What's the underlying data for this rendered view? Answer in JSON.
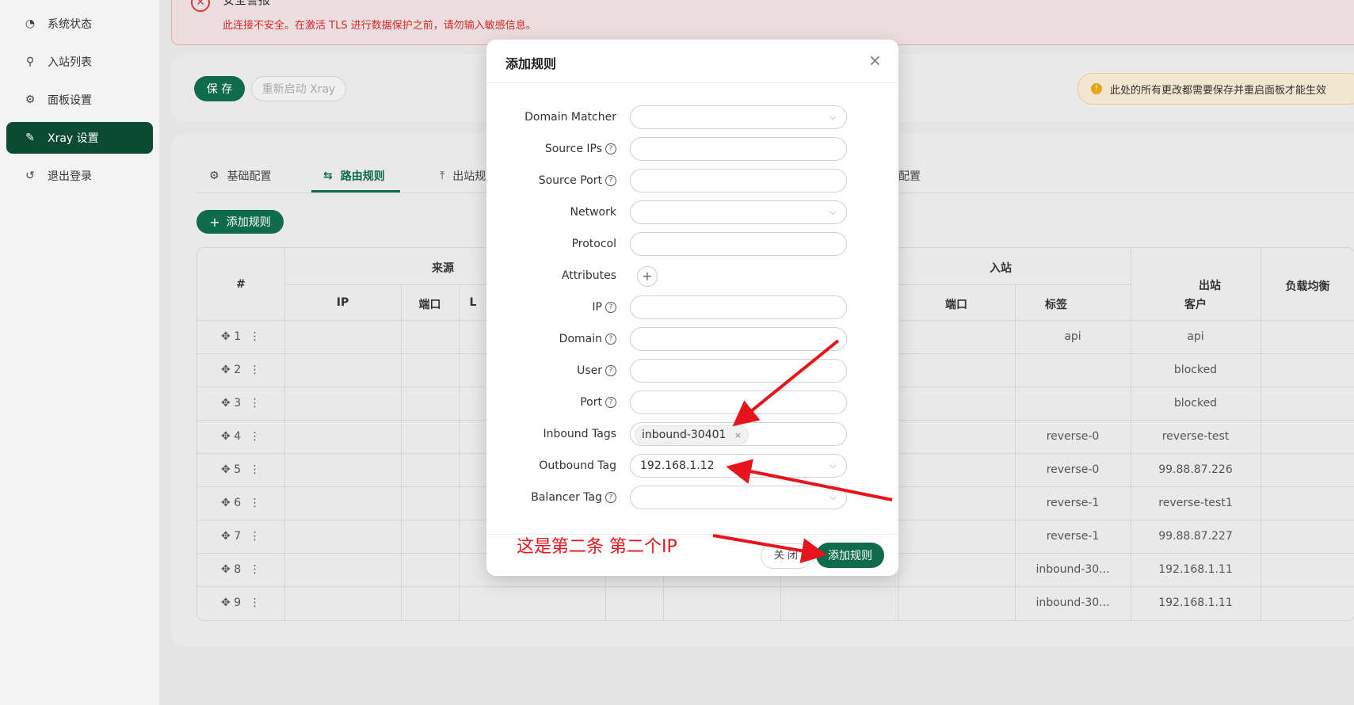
{
  "sidebar": {
    "items": [
      {
        "label": "系统状态",
        "icon": "dashboard-icon"
      },
      {
        "label": "入站列表",
        "icon": "user-icon"
      },
      {
        "label": "面板设置",
        "icon": "gear-icon"
      },
      {
        "label": "Xray 设置",
        "icon": "wrench-icon",
        "active": true
      },
      {
        "label": "退出登录",
        "icon": "logout-icon"
      }
    ]
  },
  "alert": {
    "title": "安全警报",
    "message": "此连接不安全。在激活 TLS 进行数据保护之前，请勿输入敏感信息。"
  },
  "toolbar": {
    "save_label": "保 存",
    "restart_label": "重新启动 Xray",
    "warning": "此处的所有更改都需要保存并重启面板才能生效"
  },
  "tabs": [
    {
      "label": "基础配置",
      "icon": "gear-icon"
    },
    {
      "label": "路由规则",
      "icon": "swap-icon",
      "active": true
    },
    {
      "label": "出站规",
      "icon": "upload-icon"
    },
    {
      "label": "配置",
      "icon": ""
    }
  ],
  "add_rule_label": "添加规则",
  "table": {
    "group_source": "来源",
    "group_inbound": "入站",
    "headers": {
      "index": "#",
      "ip": "IP",
      "port": "端口",
      "l": "L",
      "in_port": "端口",
      "tag": "标签",
      "client": "客户",
      "outbound": "出站",
      "balancer": "负载均衡"
    },
    "rows": [
      {
        "idx": "1",
        "tag": "api",
        "outbound": "api"
      },
      {
        "idx": "2",
        "tag": "",
        "outbound": "blocked"
      },
      {
        "idx": "3",
        "tag": "",
        "outbound": "blocked"
      },
      {
        "idx": "4",
        "tag": "reverse-0",
        "outbound": "reverse-test"
      },
      {
        "idx": "5",
        "tag": "reverse-0",
        "outbound": "99.88.87.226"
      },
      {
        "idx": "6",
        "tag": "reverse-1",
        "outbound": "reverse-test1"
      },
      {
        "idx": "7",
        "tag": "reverse-1",
        "outbound": "99.88.87.227"
      },
      {
        "idx": "8",
        "tag": "inbound-30...",
        "outbound": "192.168.1.11"
      },
      {
        "idx": "9",
        "tag": "inbound-30...",
        "outbound": "192.168.1.11"
      }
    ]
  },
  "modal": {
    "title": "添加规则",
    "fields": {
      "domain_matcher": "Domain Matcher",
      "source_ips": "Source IPs",
      "source_port": "Source Port",
      "network": "Network",
      "protocol": "Protocol",
      "attributes": "Attributes",
      "ip": "IP",
      "domain": "Domain",
      "user": "User",
      "port": "Port",
      "inbound_tags": "Inbound Tags",
      "outbound_tag": "Outbound Tag",
      "balancer_tag": "Balancer Tag"
    },
    "inbound_tag_value": "inbound-30401",
    "outbound_tag_value": "192.168.1.12",
    "close_label": "关 闭",
    "submit_label": "添加规则"
  },
  "annotation": {
    "text": "这是第二条 第二个IP",
    "color": "#e8141b"
  }
}
